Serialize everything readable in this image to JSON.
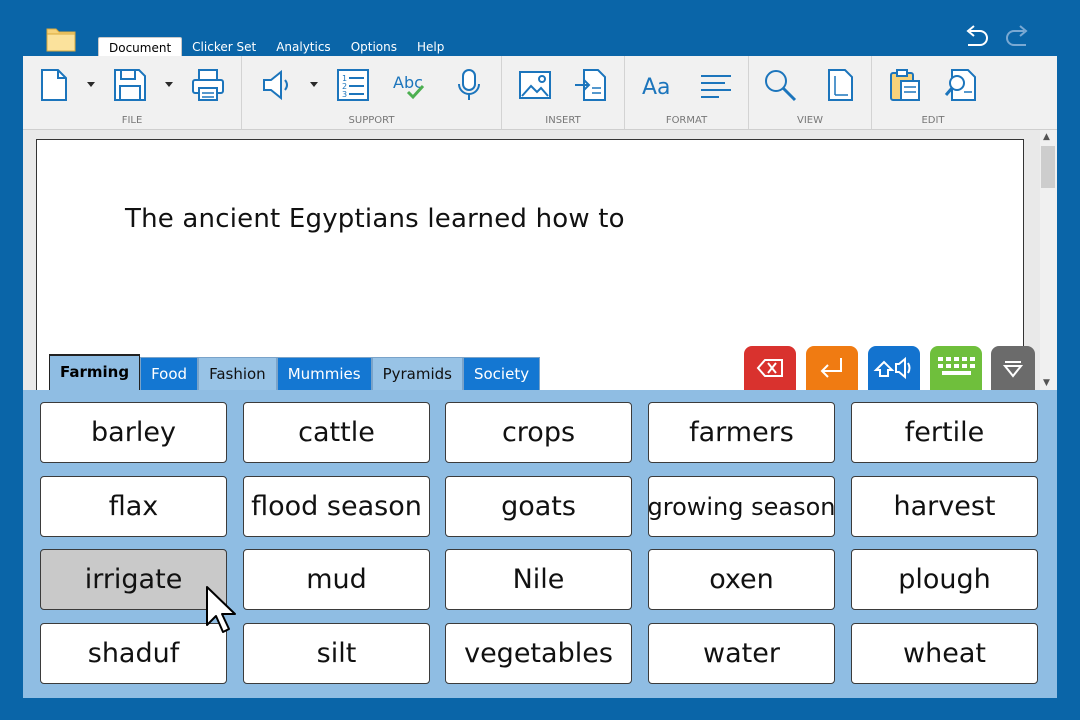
{
  "menu": {
    "tabs": [
      "Document",
      "Clicker Set",
      "Analytics",
      "Options",
      "Help"
    ],
    "active": "Document"
  },
  "ribbon": {
    "groups": [
      {
        "label": "FILE"
      },
      {
        "label": "SUPPORT"
      },
      {
        "label": "INSERT"
      },
      {
        "label": "FORMAT"
      },
      {
        "label": "VIEW"
      },
      {
        "label": "EDIT"
      }
    ],
    "icons": [
      "new-document-icon",
      "save-icon",
      "print-icon",
      "speaker-icon",
      "numbered-list-icon",
      "spellcheck-icon",
      "microphone-icon",
      "insert-picture-icon",
      "insert-file-icon",
      "font-icon",
      "paragraph-icon",
      "zoom-icon",
      "page-view-icon",
      "paste-icon",
      "find-icon"
    ]
  },
  "document": {
    "text": "The ancient Egyptians learned how to"
  },
  "clicker_tabs": [
    {
      "label": "Farming",
      "style": "active"
    },
    {
      "label": "Food",
      "style": "dark"
    },
    {
      "label": "Fashion",
      "style": "light"
    },
    {
      "label": "Mummies",
      "style": "dark"
    },
    {
      "label": "Pyramids",
      "style": "light"
    },
    {
      "label": "Society",
      "style": "dark"
    }
  ],
  "controls": [
    {
      "name": "backspace-button",
      "icon": "backspace-icon",
      "color": "#d9322e"
    },
    {
      "name": "enter-button",
      "icon": "enter-icon",
      "color": "#f07b12"
    },
    {
      "name": "speech-button",
      "icon": "speak-word-icon",
      "color": "#1373cf"
    },
    {
      "name": "keyboard-button",
      "icon": "keyboard-icon",
      "color": "#6fbf3c"
    },
    {
      "name": "hide-grid-button",
      "icon": "minimize-icon",
      "color": "#6b6b6b"
    }
  ],
  "words": [
    [
      "barley",
      "cattle",
      "crops",
      "farmers",
      "fertile"
    ],
    [
      "flax",
      "flood season",
      "goats",
      "growing season",
      "harvest"
    ],
    [
      "irrigate",
      "mud",
      "Nile",
      "oxen",
      "plough"
    ],
    [
      "shaduf",
      "silt",
      "vegetables",
      "water",
      "wheat"
    ]
  ],
  "selected_word": "irrigate",
  "colors": {
    "background": "#0a65a8",
    "grid_panel": "#8fbde3",
    "tab_dark": "#1477d2",
    "tab_light": "#98c3e6"
  }
}
